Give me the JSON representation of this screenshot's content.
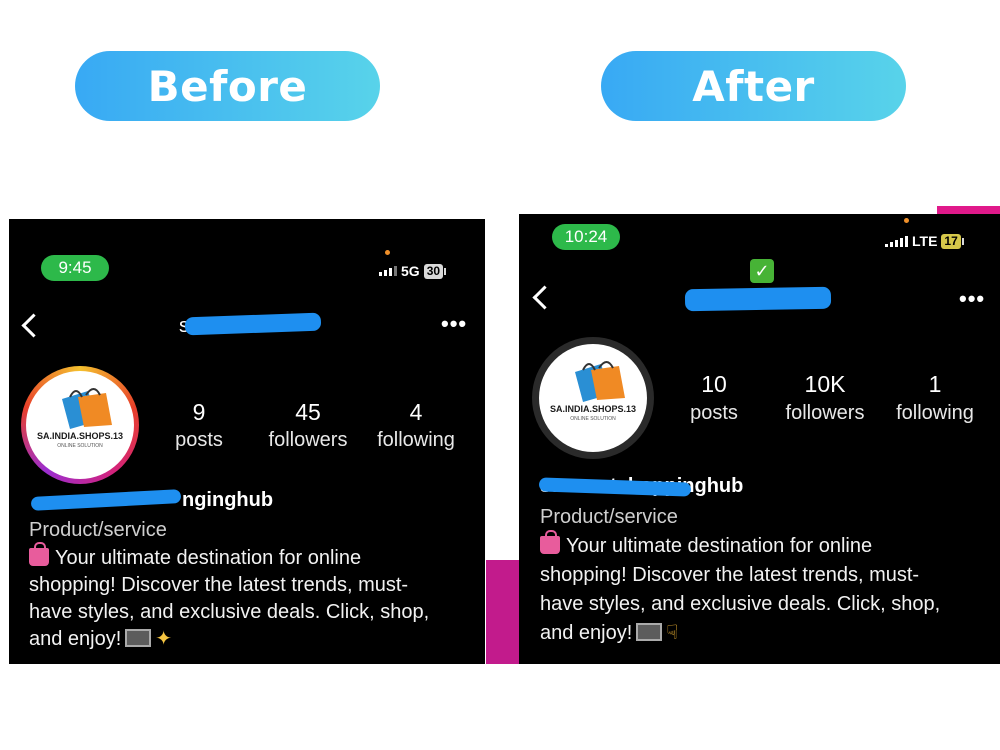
{
  "labels": {
    "before": "Before",
    "after": "After"
  },
  "before": {
    "time": "9:45",
    "network": "5G",
    "battery": "30",
    "logo_text": "SA.INDIA.SHOPS.13",
    "logo_sub": "ONLINE SOLUTION",
    "stats": [
      {
        "value": "9",
        "label": "posts"
      },
      {
        "value": "45",
        "label": "followers"
      },
      {
        "value": "4",
        "label": "following"
      }
    ],
    "username_partial": "s",
    "username_visible": "nginghub",
    "category": "Product/service",
    "bio_lines": [
      "Your ultimate destination for online",
      "shopping! Discover the latest trends, must-",
      "have styles, and exclusive deals. Click, shop,",
      "and enjoy!"
    ],
    "more_icon": "•••"
  },
  "after": {
    "time": "10:24",
    "network": "LTE",
    "battery": "17",
    "verified_icon": "✓",
    "logo_text": "SA.INDIA.SHOPS.13",
    "logo_sub": "ONLINE SOLUTION",
    "stats": [
      {
        "value": "10",
        "label": "posts"
      },
      {
        "value": "10K",
        "label": "followers"
      },
      {
        "value": "1",
        "label": "following"
      }
    ],
    "username_visible": "sasmartshoppinghub",
    "category": "Product/service",
    "bio_lines": [
      "Your ultimate destination for online",
      "shopping! Discover the latest trends, must-",
      "have styles, and exclusive deals. Click, shop,",
      "and enjoy!"
    ],
    "more_icon": "•••"
  },
  "colors": {
    "pill_start": "#38a9f4",
    "pill_end": "#58d3ea",
    "status_green": "#2db94a",
    "redaction_blue": "#1e8ff0"
  }
}
